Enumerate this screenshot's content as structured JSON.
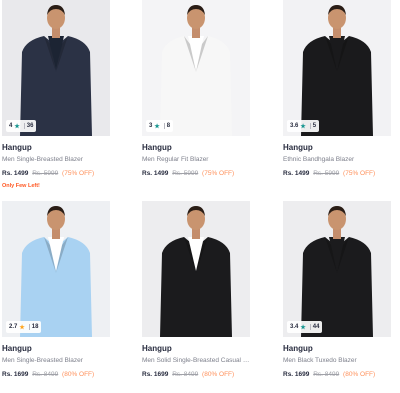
{
  "colors": {
    "accent": "#ff905a",
    "alert": "#ff5722",
    "brand_text": "#282c3f",
    "muted": "#7e808c"
  },
  "products": [
    {
      "brand": "Hangup",
      "title": "Men Single-Breasted Blazer",
      "price": "Rs. 1499",
      "mrp": "Rs. 5999",
      "discount": "(75% OFF)",
      "rating": "4",
      "rating_count": "36",
      "star_color": "#14958f",
      "note": "Only Few Left!",
      "jacket_color": "#2b3245",
      "shirt_color": "#1c2433",
      "pants_color": "#23293a",
      "bg_color": "#e9e9ec"
    },
    {
      "brand": "Hangup",
      "title": "Men Regular Fit Blazer",
      "price": "Rs. 1499",
      "mrp": "Rs. 5999",
      "discount": "(75% OFF)",
      "rating": "3",
      "rating_count": "8",
      "star_color": "#14958f",
      "note": "",
      "jacket_color": "#f7f7f7",
      "shirt_color": "#ffffff",
      "pants_color": "#f2f2f2",
      "bg_color": "#f4f4f6"
    },
    {
      "brand": "Hangup",
      "title": "Ethnic Bandhgala Blazer",
      "price": "Rs. 1499",
      "mrp": "Rs. 5999",
      "discount": "(75% OFF)",
      "rating": "3.6",
      "rating_count": "5",
      "star_color": "#14958f",
      "note": "",
      "jacket_color": "#1a1a1c",
      "shirt_color": "#1a1a1c",
      "pants_color": "#1e1e22",
      "bg_color": "#f2f2f4"
    },
    {
      "brand": "Hangup",
      "title": "Men Single-Breasted Blazer",
      "price": "Rs. 1699",
      "mrp": "Rs. 8499",
      "discount": "(80% OFF)",
      "rating": "2.7",
      "rating_count": "18",
      "star_color": "#ffa41c",
      "note": "",
      "jacket_color": "#a9d2f2",
      "shirt_color": "#ffffff",
      "pants_color": "#f0f0f0",
      "bg_color": "#eef0f3"
    },
    {
      "brand": "Hangup",
      "title": "Men Solid Single-Breasted Casual Blazer",
      "price": "Rs. 1699",
      "mrp": "Rs. 8499",
      "discount": "(80% OFF)",
      "rating": "",
      "rating_count": "",
      "star_color": "#14958f",
      "note": "",
      "jacket_color": "#1b1b1d",
      "shirt_color": "#ffffff",
      "pants_color": "#1c1c1f",
      "bg_color": "#ededef"
    },
    {
      "brand": "Hangup",
      "title": "Men Black Tuxedo Blazer",
      "price": "Rs. 1699",
      "mrp": "Rs. 8499",
      "discount": "(80% OFF)",
      "rating": "3.4",
      "rating_count": "44",
      "star_color": "#14958f",
      "note": "",
      "jacket_color": "#1b1b1d",
      "shirt_color": "#1b1b1d",
      "pants_color": "#1c1c1f",
      "bg_color": "#ededef"
    }
  ]
}
